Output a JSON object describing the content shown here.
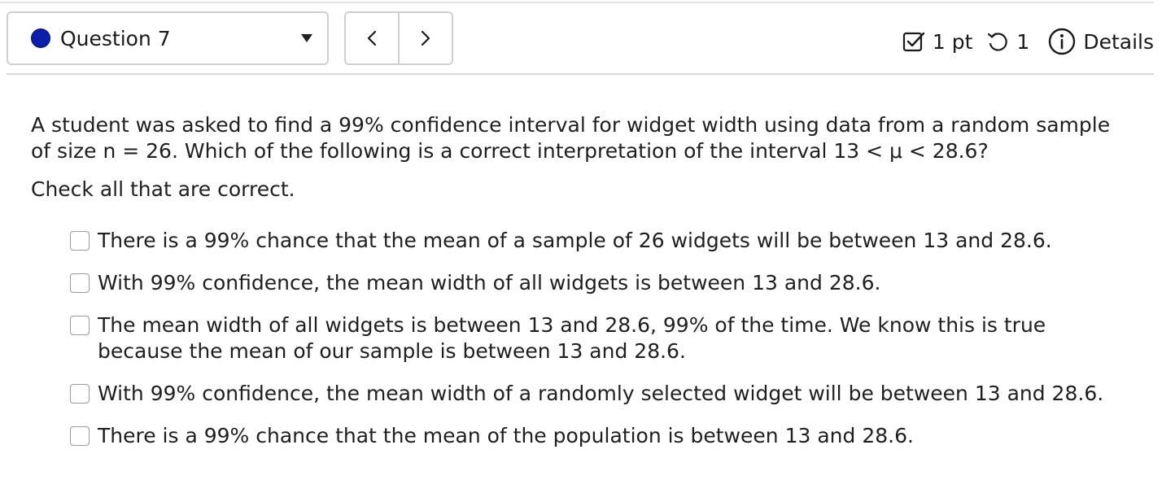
{
  "header": {
    "question_selector": {
      "label": "Question 7",
      "status_color": "#0b1fa8"
    },
    "nav": {
      "prev_icon": "chevron-left-icon",
      "next_icon": "chevron-right-icon"
    },
    "points": {
      "icon": "checkbox-icon",
      "label": "1 pt"
    },
    "attempts": {
      "icon": "retry-icon",
      "label": "1"
    },
    "details": {
      "icon": "info-icon",
      "label": "Details"
    }
  },
  "question": {
    "text": "A student was asked to find a 99% confidence interval for widget width using data from a random sample of size n = 26. Which of the following is a correct interpretation of the interval 13 < μ < 28.6?",
    "instruction": "Check all that are correct."
  },
  "choices": [
    {
      "label": "There is a 99% chance that the mean of a sample of 26 widgets will be between 13 and 28.6.",
      "checked": false
    },
    {
      "label": "With 99% confidence, the mean width of all widgets is between 13 and 28.6.",
      "checked": false
    },
    {
      "label": "The mean width of all widgets is between 13 and 28.6, 99% of the time. We know this is true because the mean of our sample is between 13 and 28.6.",
      "checked": false
    },
    {
      "label": "With 99% confidence, the mean width of a randomly selected widget will be between 13 and 28.6.",
      "checked": false
    },
    {
      "label": "There is a 99% chance that the mean of the population is between 13 and 28.6.",
      "checked": false
    }
  ]
}
